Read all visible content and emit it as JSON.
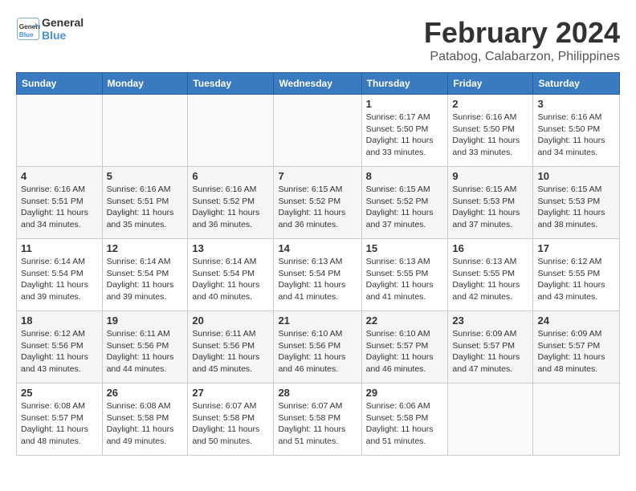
{
  "header": {
    "logo_line1": "General",
    "logo_line2": "Blue",
    "month": "February 2024",
    "location": "Patabog, Calabarzon, Philippines"
  },
  "days_of_week": [
    "Sunday",
    "Monday",
    "Tuesday",
    "Wednesday",
    "Thursday",
    "Friday",
    "Saturday"
  ],
  "weeks": [
    [
      {
        "day": "",
        "info": ""
      },
      {
        "day": "",
        "info": ""
      },
      {
        "day": "",
        "info": ""
      },
      {
        "day": "",
        "info": ""
      },
      {
        "day": "1",
        "info": "Sunrise: 6:17 AM\nSunset: 5:50 PM\nDaylight: 11 hours\nand 33 minutes."
      },
      {
        "day": "2",
        "info": "Sunrise: 6:16 AM\nSunset: 5:50 PM\nDaylight: 11 hours\nand 33 minutes."
      },
      {
        "day": "3",
        "info": "Sunrise: 6:16 AM\nSunset: 5:50 PM\nDaylight: 11 hours\nand 34 minutes."
      }
    ],
    [
      {
        "day": "4",
        "info": "Sunrise: 6:16 AM\nSunset: 5:51 PM\nDaylight: 11 hours\nand 34 minutes."
      },
      {
        "day": "5",
        "info": "Sunrise: 6:16 AM\nSunset: 5:51 PM\nDaylight: 11 hours\nand 35 minutes."
      },
      {
        "day": "6",
        "info": "Sunrise: 6:16 AM\nSunset: 5:52 PM\nDaylight: 11 hours\nand 36 minutes."
      },
      {
        "day": "7",
        "info": "Sunrise: 6:15 AM\nSunset: 5:52 PM\nDaylight: 11 hours\nand 36 minutes."
      },
      {
        "day": "8",
        "info": "Sunrise: 6:15 AM\nSunset: 5:52 PM\nDaylight: 11 hours\nand 37 minutes."
      },
      {
        "day": "9",
        "info": "Sunrise: 6:15 AM\nSunset: 5:53 PM\nDaylight: 11 hours\nand 37 minutes."
      },
      {
        "day": "10",
        "info": "Sunrise: 6:15 AM\nSunset: 5:53 PM\nDaylight: 11 hours\nand 38 minutes."
      }
    ],
    [
      {
        "day": "11",
        "info": "Sunrise: 6:14 AM\nSunset: 5:54 PM\nDaylight: 11 hours\nand 39 minutes."
      },
      {
        "day": "12",
        "info": "Sunrise: 6:14 AM\nSunset: 5:54 PM\nDaylight: 11 hours\nand 39 minutes."
      },
      {
        "day": "13",
        "info": "Sunrise: 6:14 AM\nSunset: 5:54 PM\nDaylight: 11 hours\nand 40 minutes."
      },
      {
        "day": "14",
        "info": "Sunrise: 6:13 AM\nSunset: 5:54 PM\nDaylight: 11 hours\nand 41 minutes."
      },
      {
        "day": "15",
        "info": "Sunrise: 6:13 AM\nSunset: 5:55 PM\nDaylight: 11 hours\nand 41 minutes."
      },
      {
        "day": "16",
        "info": "Sunrise: 6:13 AM\nSunset: 5:55 PM\nDaylight: 11 hours\nand 42 minutes."
      },
      {
        "day": "17",
        "info": "Sunrise: 6:12 AM\nSunset: 5:55 PM\nDaylight: 11 hours\nand 43 minutes."
      }
    ],
    [
      {
        "day": "18",
        "info": "Sunrise: 6:12 AM\nSunset: 5:56 PM\nDaylight: 11 hours\nand 43 minutes."
      },
      {
        "day": "19",
        "info": "Sunrise: 6:11 AM\nSunset: 5:56 PM\nDaylight: 11 hours\nand 44 minutes."
      },
      {
        "day": "20",
        "info": "Sunrise: 6:11 AM\nSunset: 5:56 PM\nDaylight: 11 hours\nand 45 minutes."
      },
      {
        "day": "21",
        "info": "Sunrise: 6:10 AM\nSunset: 5:56 PM\nDaylight: 11 hours\nand 46 minutes."
      },
      {
        "day": "22",
        "info": "Sunrise: 6:10 AM\nSunset: 5:57 PM\nDaylight: 11 hours\nand 46 minutes."
      },
      {
        "day": "23",
        "info": "Sunrise: 6:09 AM\nSunset: 5:57 PM\nDaylight: 11 hours\nand 47 minutes."
      },
      {
        "day": "24",
        "info": "Sunrise: 6:09 AM\nSunset: 5:57 PM\nDaylight: 11 hours\nand 48 minutes."
      }
    ],
    [
      {
        "day": "25",
        "info": "Sunrise: 6:08 AM\nSunset: 5:57 PM\nDaylight: 11 hours\nand 48 minutes."
      },
      {
        "day": "26",
        "info": "Sunrise: 6:08 AM\nSunset: 5:58 PM\nDaylight: 11 hours\nand 49 minutes."
      },
      {
        "day": "27",
        "info": "Sunrise: 6:07 AM\nSunset: 5:58 PM\nDaylight: 11 hours\nand 50 minutes."
      },
      {
        "day": "28",
        "info": "Sunrise: 6:07 AM\nSunset: 5:58 PM\nDaylight: 11 hours\nand 51 minutes."
      },
      {
        "day": "29",
        "info": "Sunrise: 6:06 AM\nSunset: 5:58 PM\nDaylight: 11 hours\nand 51 minutes."
      },
      {
        "day": "",
        "info": ""
      },
      {
        "day": "",
        "info": ""
      }
    ]
  ]
}
